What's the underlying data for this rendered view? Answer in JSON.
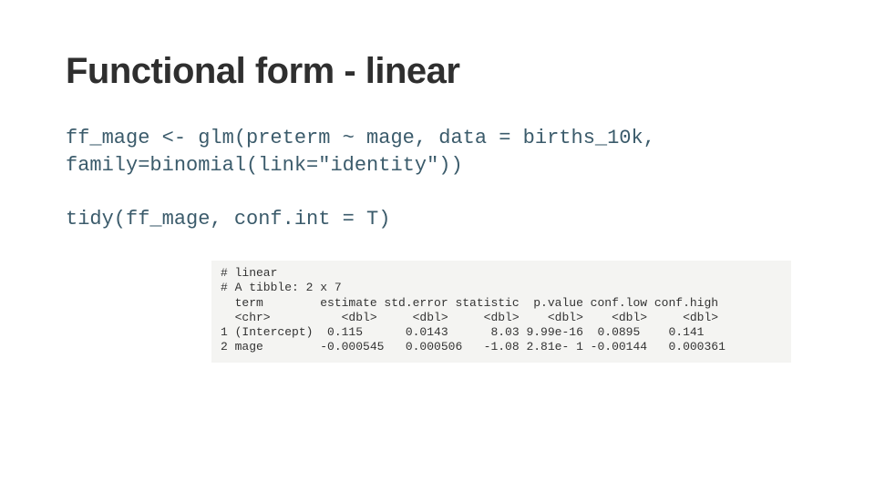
{
  "title": "Functional form - linear",
  "code": {
    "line1": "ff_mage <- glm(preterm ~ mage, data = births_10k,\nfamily=binomial(link=\"identity\"))",
    "line2": "tidy(ff_mage, conf.int = T)"
  },
  "output": {
    "text": "# linear\n# A tibble: 2 x 7\n  term        estimate std.error statistic  p.value conf.low conf.high\n  <chr>          <dbl>     <dbl>     <dbl>    <dbl>    <dbl>     <dbl>\n1 (Intercept)  0.115      0.0143      8.03 9.99e-16  0.0895    0.141\n2 mage        -0.000545   0.000506   -1.08 2.81e- 1 -0.00144   0.000361"
  }
}
